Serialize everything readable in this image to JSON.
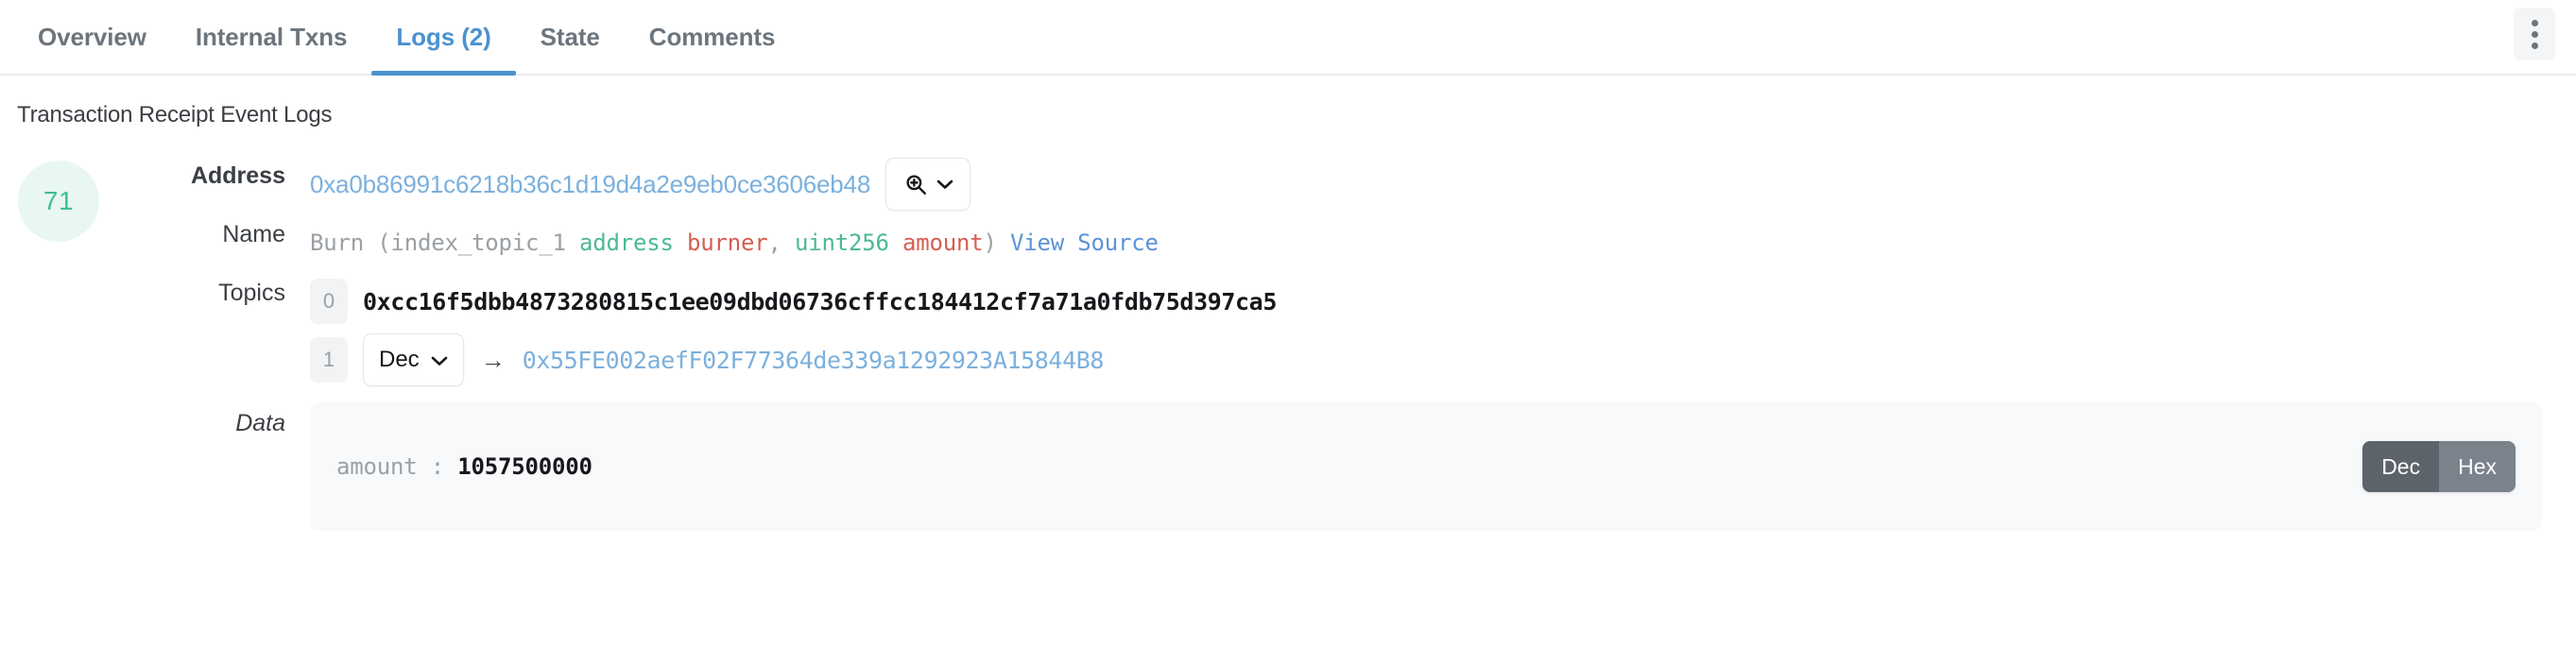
{
  "tabs": [
    {
      "label": "Overview",
      "active": false
    },
    {
      "label": "Internal Txns",
      "active": false
    },
    {
      "label": "Logs (2)",
      "active": true
    },
    {
      "label": "State",
      "active": false
    },
    {
      "label": "Comments",
      "active": false
    }
  ],
  "header": {
    "kebab_icon": "kebab-vertical-icon"
  },
  "section": {
    "caption": "Transaction Receipt Event Logs"
  },
  "log": {
    "index": "71",
    "labels": {
      "address": "Address",
      "name": "Name",
      "topics": "Topics",
      "data": "Data"
    },
    "address": {
      "value": "0xa0b86991c6218b36c1d19d4a2e9eb0ce3606eb48",
      "lookup_icon": "magnifier-plus-icon",
      "lookup_caret_icon": "chevron-down-icon"
    },
    "name": {
      "event": "Burn",
      "open_paren": "(",
      "index_topic": "index_topic_1",
      "param1_type": "address",
      "param1_name": "burner",
      "comma": ",",
      "param2_type": "uint256",
      "param2_name": "amount",
      "close_paren": ")",
      "view_source": "View Source"
    },
    "topics": [
      {
        "index": "0",
        "hash": "0xcc16f5dbb4873280815c1ee09dbd06736cffcc184412cf7a71a0fdb75d397ca5",
        "has_format_select": false,
        "has_arrow": false
      },
      {
        "index": "1",
        "format_label": "Dec",
        "format_caret_icon": "chevron-down-icon",
        "arrow_glyph": "→",
        "address": "0x55FE002aefF02F77364de339a1292923A15844B8",
        "has_format_select": true,
        "has_arrow": true
      }
    ],
    "data": {
      "key": "amount",
      "separator": ":",
      "value": "1057500000",
      "toggle": {
        "dec_label": "Dec",
        "hex_label": "Hex",
        "selected": "Dec"
      }
    }
  },
  "colors": {
    "accent_blue": "#4a92d0",
    "link_blue": "#7cb0dd",
    "badge_green_text": "#3fbf93",
    "badge_green_bg": "#e9f7f1",
    "type_green": "#4cb894",
    "arg_red": "#d35f52",
    "muted_grey": "#6c757d",
    "panel_bg": "#f8f9fa",
    "toggle_active": "#5c636a",
    "toggle_inactive": "#7a828c"
  }
}
